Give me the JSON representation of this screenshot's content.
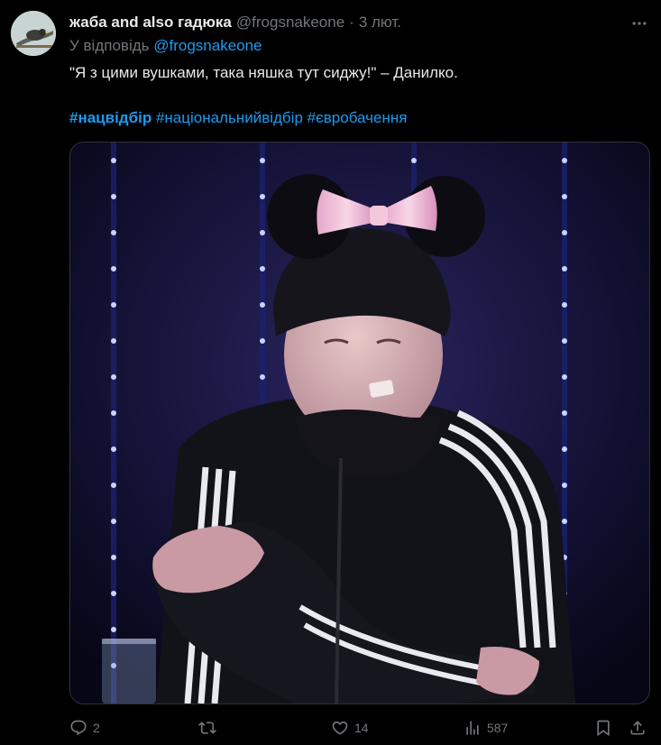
{
  "tweet": {
    "author_name": "жаба and also гадюка",
    "handle": "@frogsnakeone",
    "separator": "·",
    "date": "3 лют.",
    "reply_prefix": "У відповідь",
    "reply_to": "@frogsnakeone",
    "text": "\"Я з цими вушками, така няшка тут сиджу!\" – Данилко.",
    "hashtags": [
      "#нацвідбір",
      "#національнийвідбір",
      "#євробачення"
    ]
  },
  "actions": {
    "replies": "2",
    "retweets": "",
    "likes": "14",
    "views": "587"
  },
  "icons": {
    "more": "more-horizontal-icon",
    "reply": "reply-bubble-icon",
    "retweet": "retweet-icon",
    "like": "heart-icon",
    "views": "views-bar-chart-icon",
    "bookmark": "bookmark-icon",
    "share": "share-upload-icon"
  },
  "colors": {
    "background": "#000000",
    "text": "#e7e9ea",
    "muted": "#71767b",
    "accent": "#1d9bf0"
  }
}
